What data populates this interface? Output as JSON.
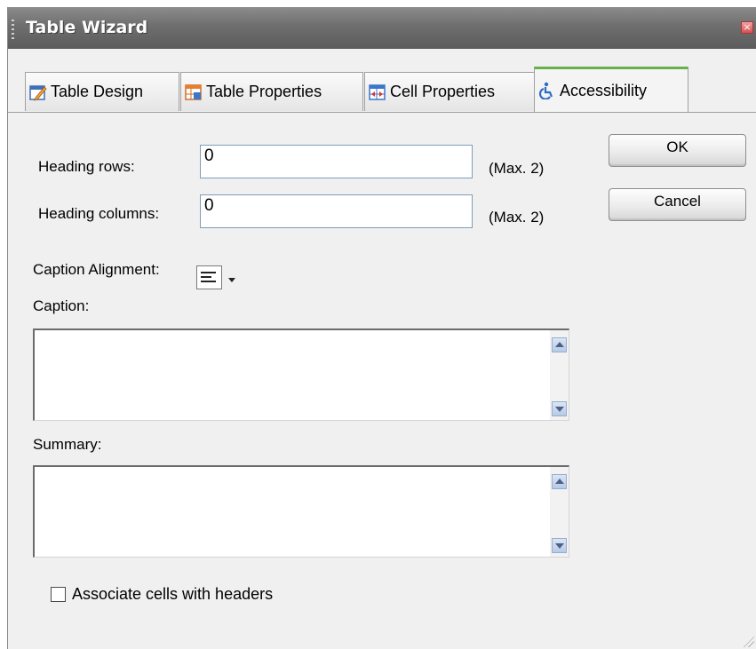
{
  "window": {
    "title": "Table Wizard",
    "close_symbol": "×"
  },
  "tabs": [
    {
      "label": "Table Design",
      "icon": "table-design-icon"
    },
    {
      "label": "Table Properties",
      "icon": "table-properties-icon"
    },
    {
      "label": "Cell Properties",
      "icon": "cell-properties-icon"
    },
    {
      "label": "Accessibility",
      "icon": "accessibility-icon",
      "active": true
    }
  ],
  "form": {
    "heading_rows_label": "Heading rows:",
    "heading_rows_value": "0",
    "heading_rows_max": "(Max. 2)",
    "heading_columns_label": "Heading columns:",
    "heading_columns_value": "0",
    "heading_columns_max": "(Max. 2)",
    "caption_alignment_label": "Caption Alignment:",
    "caption_label": "Caption:",
    "caption_value": "",
    "summary_label": "Summary:",
    "summary_value": "",
    "associate_label": "Associate cells with headers",
    "associate_checked": false
  },
  "buttons": {
    "ok": "OK",
    "cancel": "Cancel"
  },
  "colors": {
    "titlebar": "#6e6e6e",
    "active_tab_accent": "#6ab04a",
    "background": "#f0f0f0"
  }
}
